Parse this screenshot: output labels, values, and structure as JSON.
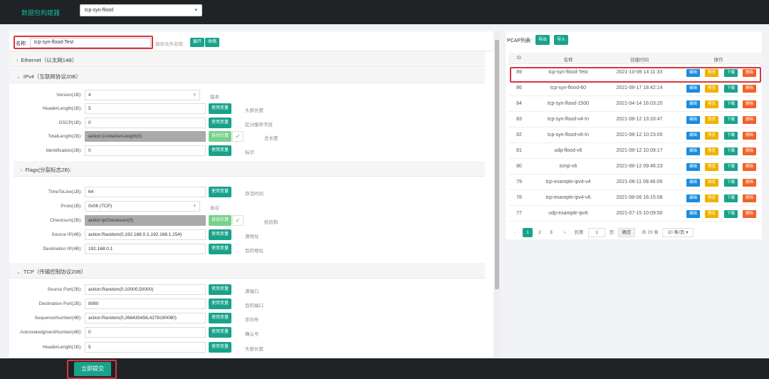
{
  "app": {
    "title": "数据包构建器"
  },
  "header_select": {
    "value": "tcp-syn-flood"
  },
  "form": {
    "name_label": "名称:",
    "name_value": "tcp-syn-flood-Test",
    "name_hint": "保存文件名称",
    "expand_label": "展开",
    "collapse_label": "收缩"
  },
  "sections": {
    "ethernet": "Ethernet（以太网14B）",
    "ipv4": "IPv4（互联网协议20B）",
    "flags": "Flags(分裂标志2B):",
    "tcp": "TCP（传输控制协议20B）"
  },
  "ipv4_fields": [
    {
      "label": "Version(1B):",
      "value": "4",
      "note": "版本"
    },
    {
      "label": "HeaderLength(1B):",
      "value": "5",
      "btn": "使用变量",
      "note": "头部长度"
    },
    {
      "label": "DSCP(1B):",
      "value": "0",
      "btn": "使用变量",
      "note": "区分服务字段"
    },
    {
      "label": "TotalLength(2B):",
      "value": "action:ContainerLength(0)",
      "btn": "自动计算",
      "note": "总长度"
    },
    {
      "label": "Identification(2B):",
      "value": "0",
      "btn": "使用变量",
      "note": "标识"
    }
  ],
  "ipv4_fields2": [
    {
      "label": "TimeToLive(1B):",
      "value": "64",
      "btn": "使用变量",
      "note": "存活时间"
    },
    {
      "label": "Proto(1B):",
      "value": "0x06 (TCP)",
      "note": "协议"
    },
    {
      "label": "Checksum(2B):",
      "value": "action:IpChecksum(0)",
      "btn": "自动计算",
      "note": "校验和"
    },
    {
      "label": "Source IP(4B):",
      "value": "action:Random(0,192.168.0.2,192.168.1.254)",
      "btn": "使用变量",
      "note": "源地址"
    },
    {
      "label": "Destination IP(4B):",
      "value": "192.168.0.1",
      "btn": "使用变量",
      "note": "目的地址"
    }
  ],
  "tcp_fields": [
    {
      "label": "Source Port(2B):",
      "value": "action:Random(0,10000,50000)",
      "btn": "使用变量",
      "note": "源端口"
    },
    {
      "label": "Destination Port(2B):",
      "value": "8080",
      "btn": "使用变量",
      "note": "目的端口"
    },
    {
      "label": "SequenceNumber(4B):",
      "value": "action:Random(0,268435456,4278190080)",
      "btn": "使用变量",
      "note": "序列号"
    },
    {
      "label": "AcknowledgmentNumber(4B):",
      "value": "0",
      "btn": "使用变量",
      "note": "确认号"
    },
    {
      "label": "HeaderLength(1B):",
      "value": "5",
      "btn": "使用变量",
      "note": "头部长度"
    }
  ],
  "submit_label": "立即提交",
  "pcap": {
    "label": "PCAP列表:",
    "export_label": "导出",
    "import_label": "导入",
    "columns": [
      "ID",
      "名称",
      "创建时间",
      "操作"
    ],
    "actions": {
      "edit": "编辑",
      "preview": "预览",
      "download": "下载",
      "delete": "删除"
    },
    "rows": [
      {
        "id": "89",
        "name": "tcp-syn-flood-Test",
        "time": "2021-10-08 14:11:33"
      },
      {
        "id": "86",
        "name": "tcp-syn-flood-60",
        "time": "2021-08-17 18:42:14"
      },
      {
        "id": "84",
        "name": "tcp-syn-flood-1500",
        "time": "2021-04-14 16:03:20"
      },
      {
        "id": "83",
        "name": "tcp-syn-flood-v4-In",
        "time": "2021-08-12 13:33:47"
      },
      {
        "id": "82",
        "name": "tcp-syn-flood-v6-In",
        "time": "2021-08-12 10:23:05"
      },
      {
        "id": "81",
        "name": "udp-flood-v6",
        "time": "2021-08-12 10:09:17"
      },
      {
        "id": "80",
        "name": "icmp-v6",
        "time": "2021-08-12 09:46:23"
      },
      {
        "id": "79",
        "name": "tcp-example-ipv4-v4",
        "time": "2021-08-11 09:46:09"
      },
      {
        "id": "78",
        "name": "tcp-example-ipv4-v6",
        "time": "2021-08-06 16:15:08"
      },
      {
        "id": "77",
        "name": "udp-example-ipv6",
        "time": "2021-07-15 10:09:50"
      }
    ],
    "pager": {
      "prev": "‹",
      "pages": [
        "1",
        "2",
        "3"
      ],
      "next": "›",
      "goto_label": "到第",
      "goto_value": "1",
      "page_suffix": "页",
      "confirm": "确定",
      "total": "共 29 条",
      "page_size": "10 条/页"
    }
  }
}
